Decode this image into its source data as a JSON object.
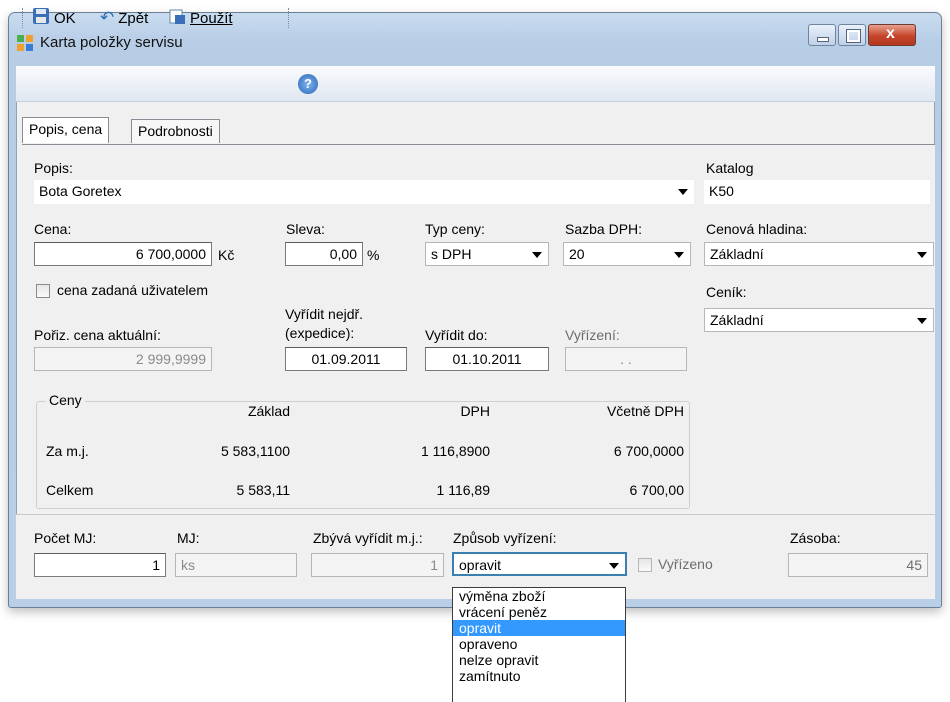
{
  "window": {
    "title": "Karta položky servisu",
    "icon": "service-card-icon"
  },
  "toolbar": {
    "ok": "OK",
    "back": "Zpět",
    "apply": "Použít",
    "help_icon": "help-icon"
  },
  "tabs": [
    {
      "label": "Popis, cena"
    },
    {
      "label": "Podrobnosti"
    }
  ],
  "form": {
    "popis_label": "Popis:",
    "popis_value": "Bota Goretex",
    "katalog_label": "Katalog",
    "katalog_value": "K50",
    "cena_label": "Cena:",
    "cena_value": "6 700,0000",
    "cena_unit": "Kč",
    "sleva_label": "Sleva:",
    "sleva_value": "0,00",
    "sleva_unit": "%",
    "typ_ceny_label": "Typ ceny:",
    "typ_ceny_value": "s DPH",
    "sazba_label": "Sazba DPH:",
    "sazba_value": "20",
    "cenova_hladina_label": "Cenová hladina:",
    "cenova_hladina_value": "Základní",
    "cena_uzivatelem_label": "cena zadaná uživatelem",
    "cenik_label": "Ceník:",
    "cenik_value": "Základní",
    "poriz_label": "Pořiz. cena aktuální:",
    "poriz_value": "2 999,9999",
    "vyridit_nejdr_label1": "Vyřídit nejdř.",
    "vyridit_nejdr_label2": "(expedice):",
    "vyridit_nejdr_value": "01.09.2011",
    "vyridit_do_label": "Vyřídit do:",
    "vyridit_do_value": "01.10.2011",
    "vyrizeni_label": "Vyřízení:",
    "vyrizeni_value": ". ."
  },
  "ceny": {
    "title": "Ceny",
    "headers": [
      "Základ",
      "DPH",
      "Včetně DPH"
    ],
    "rows": [
      {
        "label": "Za m.j.",
        "zaklad": "5 583,1100",
        "dph": "1 116,8900",
        "vcetne": "6 700,0000"
      },
      {
        "label": "Celkem",
        "zaklad": "5 583,11",
        "dph": "1 116,89",
        "vcetne": "6 700,00"
      }
    ]
  },
  "bottom": {
    "pocet_label": "Počet MJ:",
    "pocet_value": "1",
    "mj_label": "MJ:",
    "mj_value": "ks",
    "zbyva_label": "Zbývá vyřídit m.j.:",
    "zbyva_value": "1",
    "zpusob_label": "Způsob vyřízení:",
    "zpusob_value": "opravit",
    "vyrizeno_label": "Vyřízeno",
    "zasoba_label": "Zásoba:",
    "zasoba_value": "45"
  },
  "dropdown": {
    "options": [
      "výměna zboží",
      "vrácení peněz",
      "opravit",
      "opraveno",
      "nelze opravit",
      "zamítnuto"
    ],
    "selected": "opravit"
  }
}
